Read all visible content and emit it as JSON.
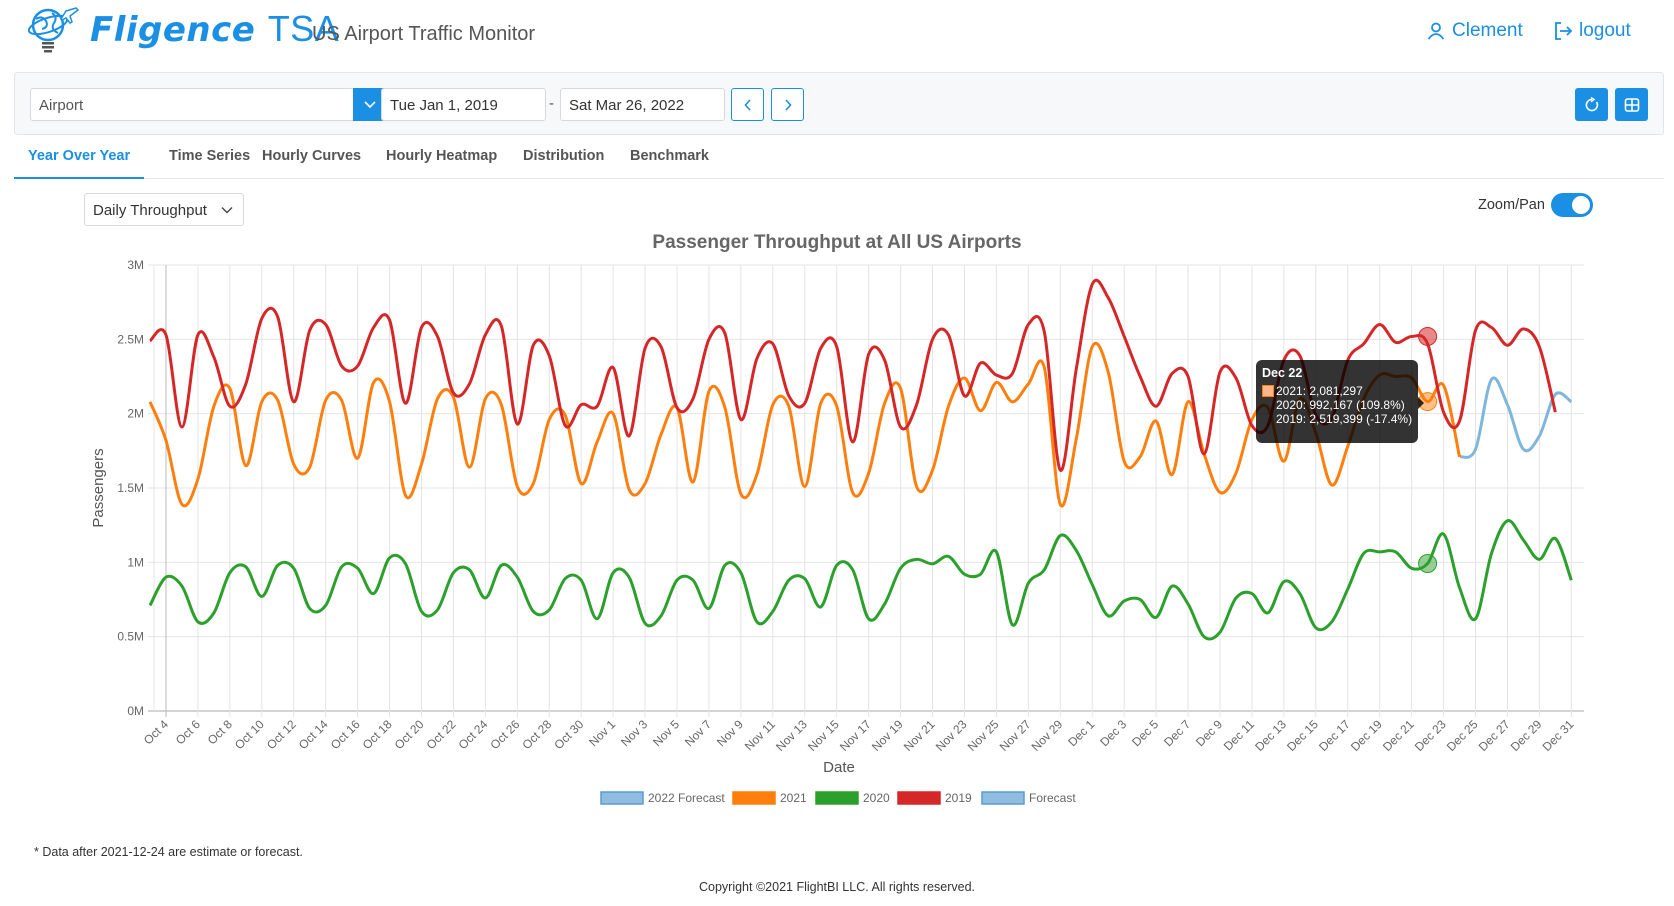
{
  "header": {
    "brand": "Fligence",
    "brand_suffix": "TSA",
    "subtitle": "US Airport Traffic Monitor",
    "user": "Clement",
    "logout": "logout"
  },
  "toolbar": {
    "airport_placeholder": "Airport",
    "start_date": "Tue Jan 1, 2019",
    "date_separator": "-",
    "end_date": "Sat Mar 26, 2022"
  },
  "tabs": [
    {
      "label": "Year Over Year",
      "active": true
    },
    {
      "label": "Time Series",
      "active": false
    },
    {
      "label": "Hourly Curves",
      "active": false
    },
    {
      "label": "Hourly Heatmap",
      "active": false
    },
    {
      "label": "Distribution",
      "active": false
    },
    {
      "label": "Benchmark",
      "active": false
    }
  ],
  "controls": {
    "metric": "Daily Throughput",
    "zoom_pan_label": "Zoom/Pan",
    "zoom_pan_enabled": true
  },
  "colors": {
    "accent": "#1a8fe3",
    "s2021": "#ff7f0e",
    "s2020": "#2ca02c",
    "s2019": "#d62728",
    "forecast": "#7fb6dc"
  },
  "tooltip": {
    "title": "Dec 22",
    "lines": [
      "2021: 2,081,297",
      "2020: 992,167 (109.8%)",
      "2019: 2,519,399 (-17.4%)"
    ]
  },
  "chart_data": {
    "type": "line",
    "title": "Passenger Throughput at All US Airports",
    "xlabel": "Date",
    "ylabel": "Passengers",
    "ylim": [
      0,
      3000000
    ],
    "yticks": [
      "0M",
      "0.5M",
      "1M",
      "1.5M",
      "2M",
      "2.5M",
      "3M"
    ],
    "xticks": [
      "Oct 4",
      "Oct 6",
      "Oct 8",
      "Oct 10",
      "Oct 12",
      "Oct 14",
      "Oct 16",
      "Oct 18",
      "Oct 20",
      "Oct 22",
      "Oct 24",
      "Oct 26",
      "Oct 28",
      "Oct 30",
      "Nov 1",
      "Nov 3",
      "Nov 5",
      "Nov 7",
      "Nov 9",
      "Nov 11",
      "Nov 13",
      "Nov 15",
      "Nov 17",
      "Nov 19",
      "Nov 21",
      "Nov 23",
      "Nov 25",
      "Nov 27",
      "Nov 29",
      "Dec 1",
      "Dec 3",
      "Dec 5",
      "Dec 7",
      "Dec 9",
      "Dec 11",
      "Dec 13",
      "Dec 15",
      "Dec 17",
      "Dec 19",
      "Dec 21",
      "Dec 23",
      "Dec 25",
      "Dec 27",
      "Dec 29",
      "Dec 31"
    ],
    "x_start": "Oct 3",
    "x_end": "Dec 31",
    "grid": true,
    "legend_position": "bottom",
    "legend": [
      "2022 Forecast",
      "2021",
      "2020",
      "2019",
      "Forecast"
    ],
    "series": [
      {
        "name": "2021",
        "start_index": 0,
        "values": [
          2080000,
          1820000,
          1390000,
          1560000,
          2050000,
          2170000,
          1650000,
          2080000,
          2090000,
          1660000,
          1640000,
          2090000,
          2090000,
          1700000,
          2210000,
          2080000,
          1450000,
          1660000,
          2100000,
          2110000,
          1640000,
          2100000,
          2060000,
          1510000,
          1530000,
          1960000,
          1990000,
          1530000,
          1810000,
          2000000,
          1490000,
          1530000,
          1860000,
          2040000,
          1540000,
          2150000,
          2040000,
          1460000,
          1590000,
          2060000,
          2050000,
          1510000,
          2070000,
          2050000,
          1470000,
          1600000,
          2070000,
          2170000,
          1510000,
          1620000,
          2050000,
          2240000,
          2020000,
          2210000,
          2080000,
          2200000,
          2310000,
          1390000,
          1830000,
          2450000,
          2280000,
          1680000,
          1710000,
          1950000,
          1590000,
          2080000,
          1730000,
          1470000,
          1600000,
          1960000,
          2040000,
          1680000,
          2100000,
          1870000,
          1520000,
          1780000,
          2100000,
          2260000,
          2250000,
          2240000,
          2081297,
          2190000,
          1710000
        ]
      },
      {
        "name": "2020",
        "start_index": 0,
        "values": [
          710000,
          900000,
          840000,
          600000,
          660000,
          930000,
          970000,
          770000,
          980000,
          960000,
          690000,
          710000,
          970000,
          960000,
          790000,
          1030000,
          990000,
          670000,
          680000,
          930000,
          950000,
          760000,
          980000,
          900000,
          670000,
          680000,
          890000,
          880000,
          620000,
          930000,
          900000,
          590000,
          640000,
          880000,
          880000,
          690000,
          980000,
          930000,
          600000,
          670000,
          880000,
          890000,
          700000,
          980000,
          950000,
          620000,
          720000,
          960000,
          1020000,
          990000,
          1040000,
          920000,
          920000,
          1070000,
          580000,
          860000,
          950000,
          1180000,
          1080000,
          850000,
          640000,
          740000,
          750000,
          630000,
          840000,
          720000,
          500000,
          530000,
          760000,
          790000,
          660000,
          870000,
          790000,
          560000,
          600000,
          820000,
          1060000,
          1070000,
          1070000,
          960000,
          992167,
          1190000,
          830000,
          620000,
          1060000,
          1280000,
          1150000,
          1020000,
          1160000,
          880000
        ]
      },
      {
        "name": "2019",
        "start_index": 0,
        "values": [
          2490000,
          2530000,
          1910000,
          2530000,
          2380000,
          2050000,
          2200000,
          2640000,
          2650000,
          2080000,
          2560000,
          2600000,
          2320000,
          2320000,
          2580000,
          2630000,
          2070000,
          2580000,
          2520000,
          2140000,
          2200000,
          2530000,
          2590000,
          1930000,
          2460000,
          2390000,
          1920000,
          2060000,
          2050000,
          2310000,
          1850000,
          2440000,
          2450000,
          2040000,
          2100000,
          2500000,
          2540000,
          1960000,
          2370000,
          2470000,
          2120000,
          2070000,
          2440000,
          2450000,
          1810000,
          2400000,
          2360000,
          1910000,
          2060000,
          2500000,
          2530000,
          2120000,
          2340000,
          2260000,
          2270000,
          2600000,
          2550000,
          1620000,
          2300000,
          2870000,
          2780000,
          2520000,
          2250000,
          2050000,
          2270000,
          2250000,
          1730000,
          2280000,
          2240000,
          1920000,
          1920000,
          2360000,
          2390000,
          1990000,
          1970000,
          2360000,
          2470000,
          2600000,
          2480000,
          2519399,
          2470000,
          2010000,
          1950000,
          2560000,
          2580000,
          2460000,
          2570000,
          2450000,
          2010000
        ]
      },
      {
        "name": "Forecast",
        "start_index": 82,
        "values": [
          1710000,
          1760000,
          2230000,
          2060000,
          1760000,
          1850000,
          2130000,
          2080000
        ]
      }
    ],
    "highlight": {
      "date": "Dec 22",
      "2021": 2081297,
      "2020": 992167,
      "2019": 2519399
    }
  },
  "footer": {
    "note": "* Data after 2021-12-24 are estimate or forecast.",
    "copyright": "Copyright ©2021 FlightBI LLC. All rights reserved."
  }
}
